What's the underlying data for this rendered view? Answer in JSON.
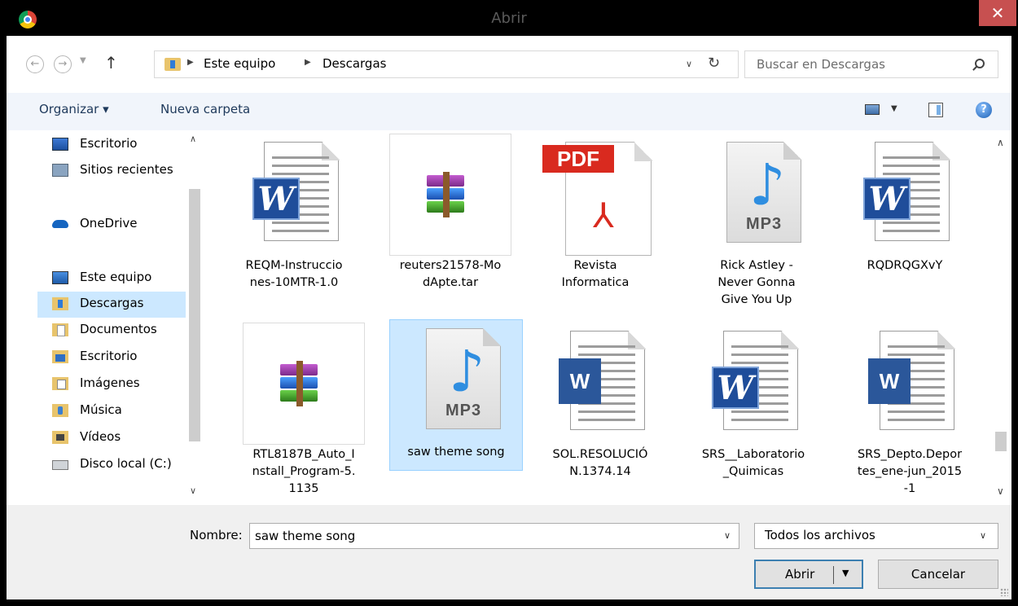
{
  "window": {
    "title": "Abrir",
    "close_label": "✕"
  },
  "addressbar": {
    "breadcrumbs": [
      "Este equipo",
      "Descargas"
    ],
    "search_placeholder": "Buscar en Descargas"
  },
  "toolbar": {
    "organize_label": "Organizar ▾",
    "new_folder_label": "Nueva carpeta",
    "help_label": "?"
  },
  "sidebar": {
    "items": [
      {
        "label": "Escritorio",
        "icon": "desktop-icon"
      },
      {
        "label": "Sitios recientes",
        "icon": "recent-places-icon"
      },
      {
        "label": "OneDrive",
        "icon": "onedrive-cloud-icon"
      },
      {
        "label": "Este equipo",
        "icon": "computer-icon"
      },
      {
        "label": "Descargas",
        "icon": "downloads-folder-icon"
      },
      {
        "label": "Documentos",
        "icon": "documents-folder-icon"
      },
      {
        "label": "Escritorio",
        "icon": "desktop-folder-icon"
      },
      {
        "label": "Imágenes",
        "icon": "pictures-folder-icon"
      },
      {
        "label": "Música",
        "icon": "music-folder-icon"
      },
      {
        "label": "Vídeos",
        "icon": "videos-folder-icon"
      },
      {
        "label": "Disco local (C:)",
        "icon": "local-disk-icon"
      }
    ],
    "selected": "Descargas"
  },
  "files": [
    {
      "name": "REQM-Instrucciones-10MTR-1.0",
      "lines": [
        "REQM-Instruccio",
        "nes-10MTR-1.0"
      ],
      "type": "word-doc"
    },
    {
      "name": "reuters21578-ModApte.tar",
      "lines": [
        "reuters21578-Mo",
        "dApte.tar"
      ],
      "type": "rar-archive"
    },
    {
      "name": "Revista Informatica",
      "lines": [
        "Revista",
        "Informatica"
      ],
      "type": "pdf",
      "badge": "PDF"
    },
    {
      "name": "Rick Astley - Never Gonna Give You Up",
      "lines": [
        "Rick Astley -",
        "Never Gonna",
        "Give You Up"
      ],
      "type": "mp3",
      "badge": "MP3"
    },
    {
      "name": "RQDRQGXvY",
      "lines": [
        "RQDRQGXvY"
      ],
      "type": "word-doc"
    },
    {
      "name": "RTL8187B_Auto_Install_Program-5.1135",
      "lines": [
        "RTL8187B_Auto_I",
        "nstall_Program-5.",
        "1135"
      ],
      "type": "rar-archive"
    },
    {
      "name": "saw theme song",
      "lines": [
        "saw theme song"
      ],
      "type": "mp3",
      "badge": "MP3",
      "selected": true
    },
    {
      "name": "SOL.RESOLUCIÓN.1374.14",
      "lines": [
        "SOL.RESOLUCIÓ",
        "N.1374.14"
      ],
      "type": "word-docx"
    },
    {
      "name": "SRS__Laboratorio_Quimicas",
      "lines": [
        "SRS__Laboratorio",
        "_Quimicas"
      ],
      "type": "word-doc"
    },
    {
      "name": "SRS_Depto.Deportes_ene-jun_2015-1",
      "lines": [
        "SRS_Depto.Depor",
        "tes_ene-jun_2015",
        "-1"
      ],
      "type": "word-docx"
    }
  ],
  "icons": {
    "word_old_letter": "W",
    "word_new_letter": "W",
    "music_note": "♪",
    "acrobat_glyph": "⅄"
  },
  "footer": {
    "name_label": "Nombre:",
    "name_value": "saw theme song",
    "file_type": "Todos los archivos",
    "open_label": "Abrir",
    "cancel_label": "Cancelar"
  }
}
